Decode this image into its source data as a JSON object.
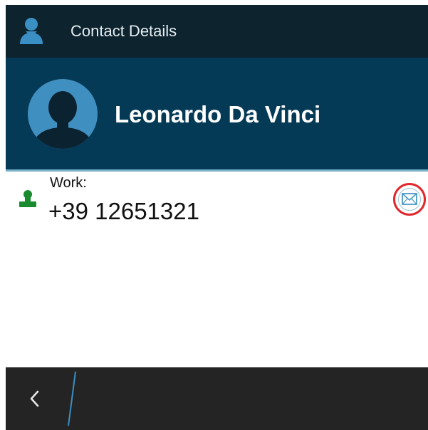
{
  "titlebar": {
    "title": "Contact Details",
    "icon": "contact-icon"
  },
  "header": {
    "contact_name": "Leonardo Da Vinci",
    "avatar": "avatar-silhouette-icon"
  },
  "phone": {
    "label": "Work:",
    "number": "+39 12651321",
    "icon": "person-icon",
    "action_icon": "envelope-icon"
  },
  "bottombar": {
    "back_icon": "chevron-left-icon"
  },
  "colors": {
    "titlebar_bg": "#0d232e",
    "header_bg": "#053a56",
    "accent_blue": "#3a8fc4",
    "green_icon": "#1a8a2e",
    "highlight_red": "#e0282d",
    "bottombar_bg": "#242424"
  }
}
